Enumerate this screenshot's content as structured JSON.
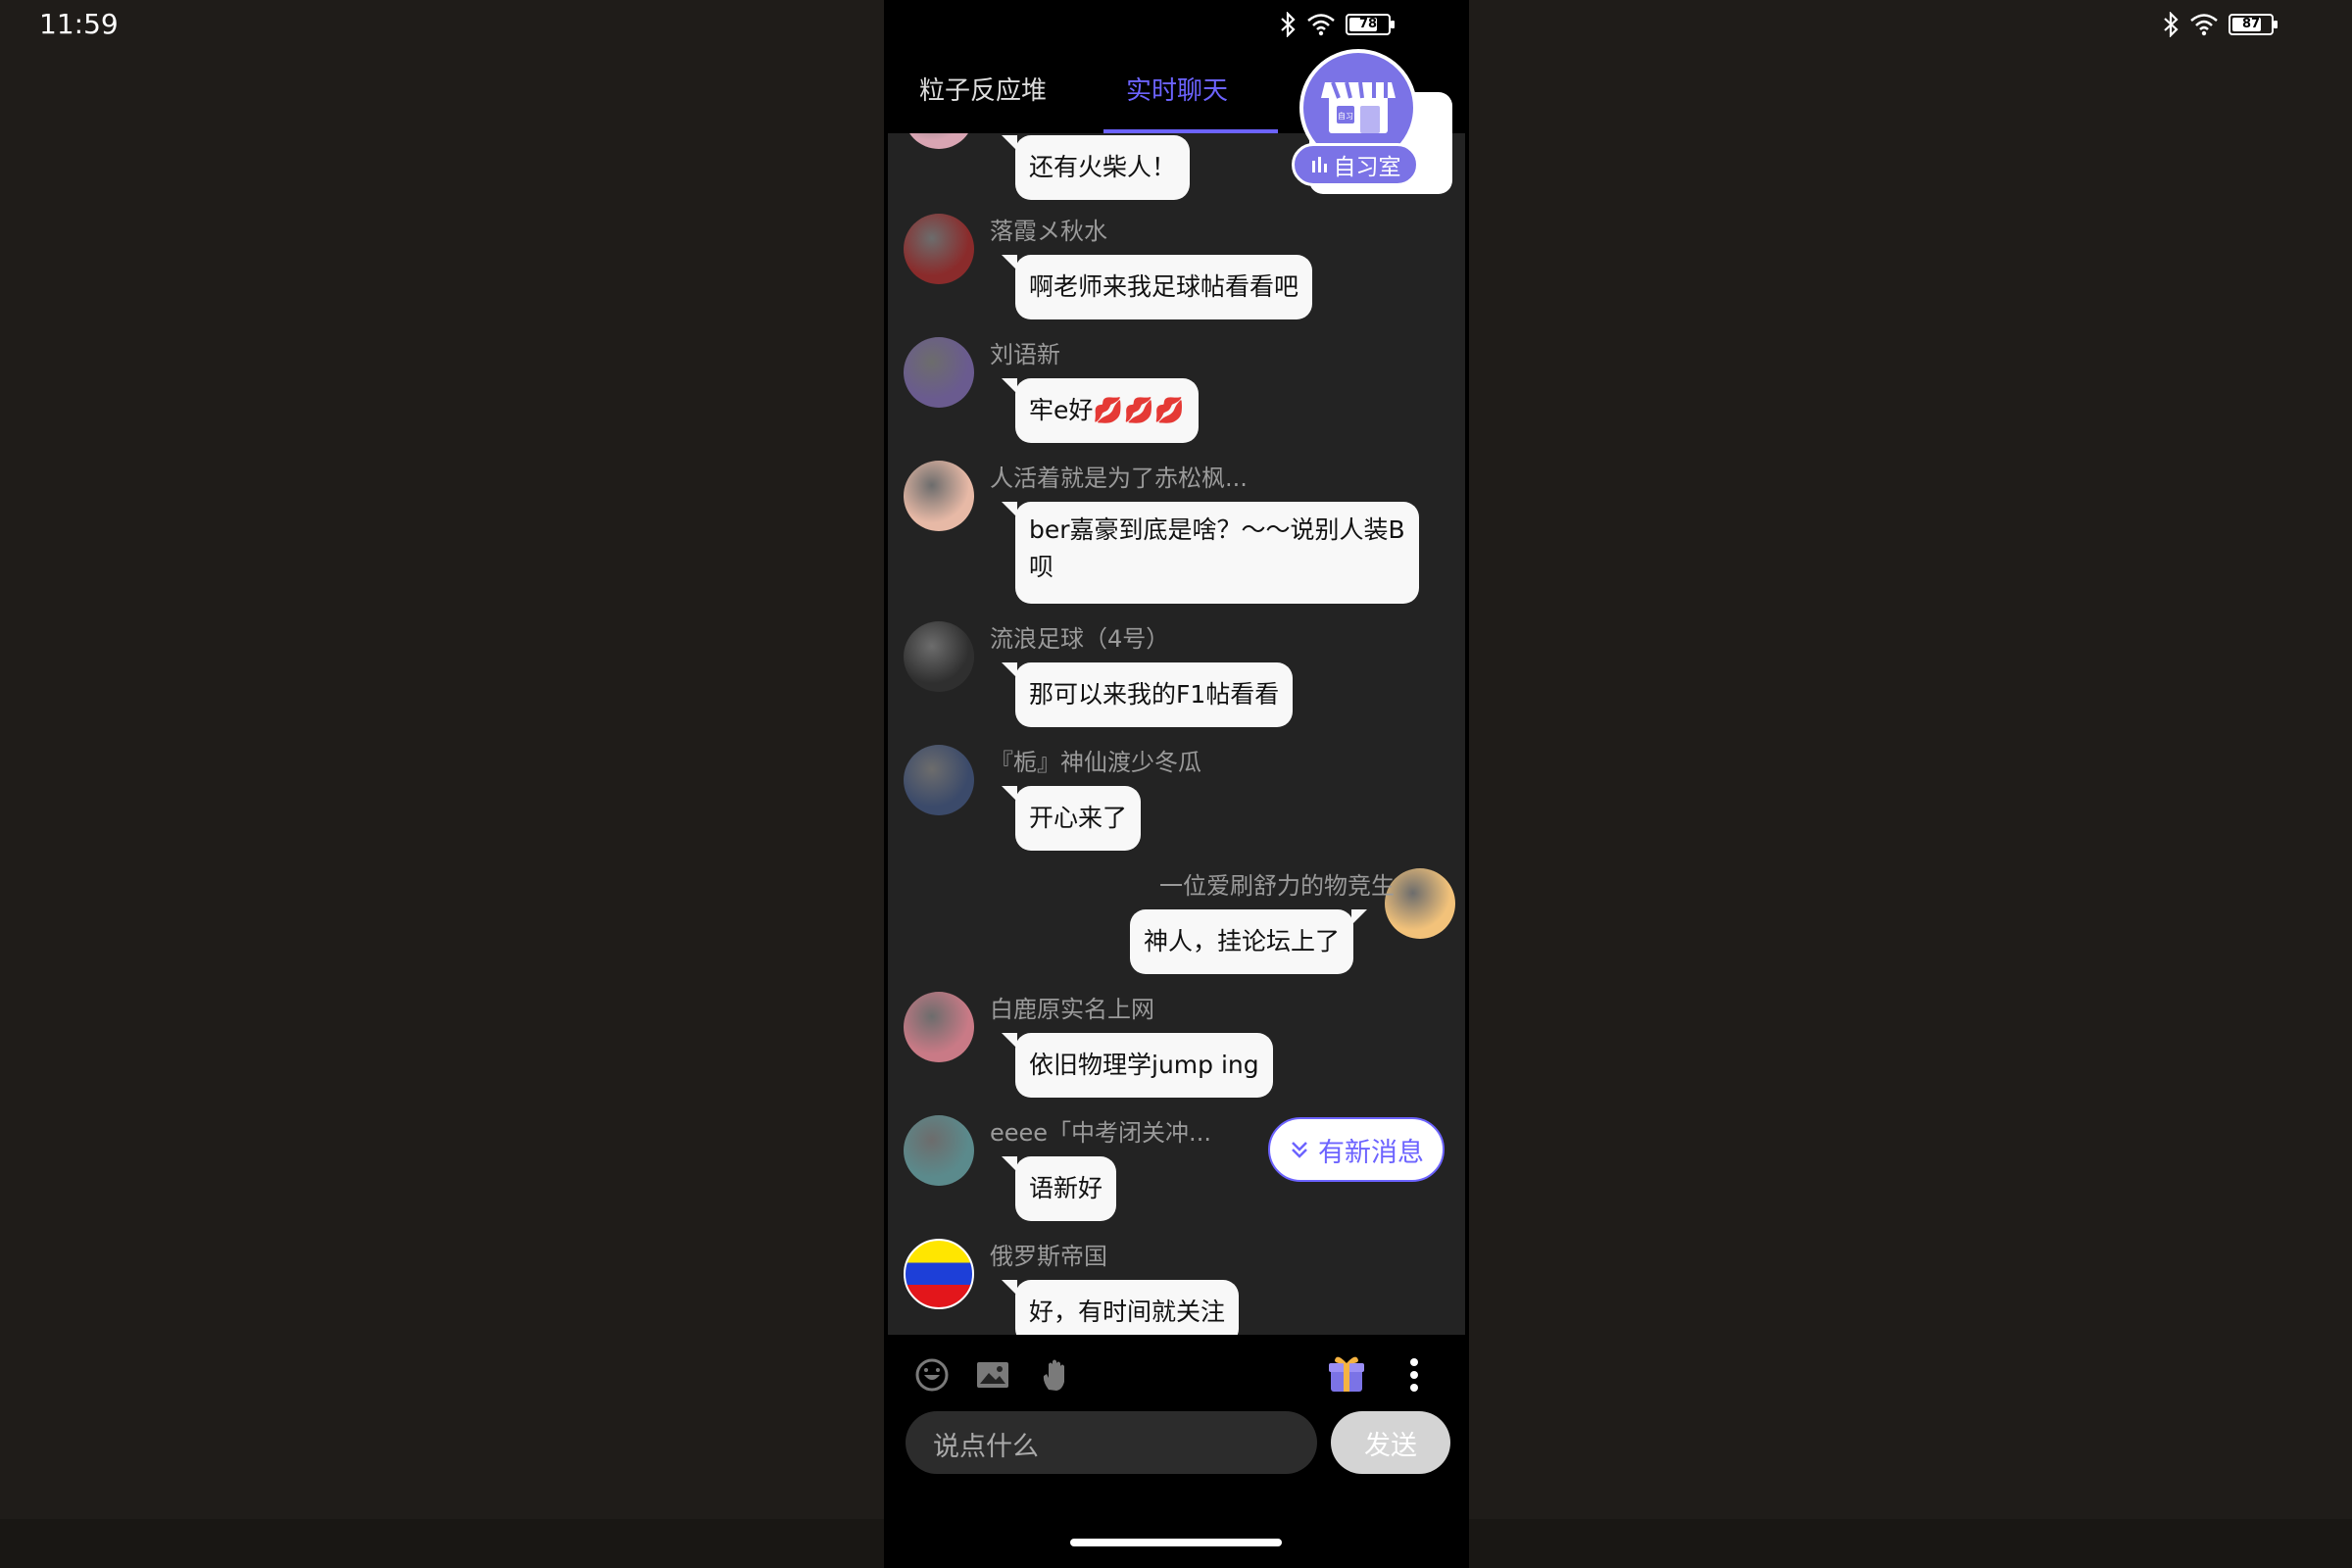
{
  "outer_status": {
    "time": "11:59",
    "battery": "87"
  },
  "phone_status": {
    "battery": "78"
  },
  "tabs": [
    {
      "label": "粒子反应堆",
      "active": false
    },
    {
      "label": "实时聊天",
      "active": true
    }
  ],
  "study_room": {
    "label": "自习室",
    "badge": "自习"
  },
  "messages": [
    {
      "user": "",
      "text": "还有火柴人！",
      "side": "left",
      "avatar_color": "#d9a5b3"
    },
    {
      "user": "落霞メ秋水",
      "text": "啊老师来我足球帖看看吧",
      "side": "left",
      "avatar_color": "#8a2b2b"
    },
    {
      "user": "刘语新",
      "text": "牢e好💋💋💋",
      "side": "left",
      "avatar_color": "#6a5b8f"
    },
    {
      "user": "人活着就是为了赤松枫...",
      "text": "ber嘉豪到底是啥？〜〜说别人装B呗",
      "side": "left",
      "avatar_color": "#e7b9a6"
    },
    {
      "user": "流浪足球（4号）",
      "text": "那可以来我的F1帖看看",
      "side": "left",
      "avatar_color": "#2f2f2f"
    },
    {
      "user": "『栀』神仙渡少冬瓜",
      "text": "开心来了",
      "side": "left",
      "avatar_color": "#3b4a6a"
    },
    {
      "user": "一位爱刷舒力的物竞生",
      "text": "神人，挂论坛上了",
      "side": "right",
      "avatar_color": "#f2c27a"
    },
    {
      "user": "白鹿原实名上网",
      "text": "依旧物理学jump ing",
      "side": "left",
      "avatar_color": "#c97a86"
    },
    {
      "user": "eeee「中考闭关冲...",
      "text": "语新好",
      "side": "left",
      "avatar_color": "#5b8a8c"
    },
    {
      "user": "俄罗斯帝国",
      "text": "好，有时间就关注",
      "side": "left",
      "avatar_color": "#ffffff"
    }
  ],
  "new_message_label": "有新消息",
  "input": {
    "placeholder": "说点什么"
  },
  "send_label": "发送",
  "colors": {
    "accent": "#6c63ff",
    "chat_bg": "#232323",
    "bubble": "#f8f8f8"
  },
  "toolbar_icons": [
    "emoji-icon",
    "image-icon",
    "hand-icon",
    "gift-icon",
    "more-icon"
  ]
}
